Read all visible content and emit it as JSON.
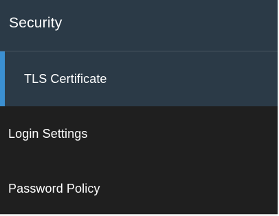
{
  "sidebar": {
    "section_title": "Security",
    "items": [
      {
        "label": "TLS Certificate",
        "active": true
      },
      {
        "label": "Login Settings",
        "active": false
      },
      {
        "label": "Password Policy",
        "active": false
      }
    ]
  },
  "colors": {
    "panel_bg": "#1f1f1f",
    "header_bg": "#2b3a47",
    "active_bg": "#2b3a47",
    "accent": "#3b8fd1",
    "text": "#ffffff"
  }
}
